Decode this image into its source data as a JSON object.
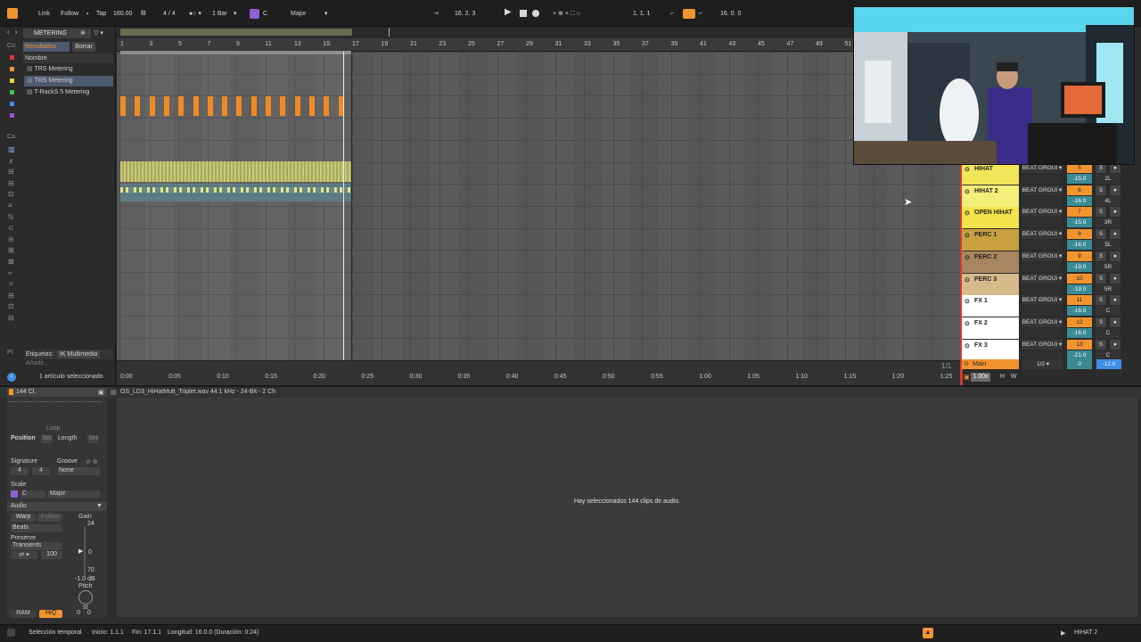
{
  "topbar": {
    "link": "Link",
    "follow": "Follow",
    "tap": "Tap",
    "tempo": "160.00",
    "signature": "4 / 4",
    "quantize": "1 Bar",
    "key": "C",
    "scale": "Major",
    "position": "16.  2.  3",
    "loop_start": "1.  1.  1",
    "loop_length": "16.  0.  0"
  },
  "browser": {
    "title": "METERING",
    "results_label": "Resultados",
    "clear_label": "Borrar",
    "column_name": "Nombre",
    "items": [
      "TRS Metering",
      "TRS Metering",
      "T-RackS 5 Metering"
    ],
    "tags_label": "Etiquetas:",
    "tags_value": "IK Multimedia",
    "add_label": "Añadir...",
    "selected_info": "1 artículo seleccionado",
    "sidebar_labels": [
      "Co.",
      "Ca.",
      "Pl."
    ]
  },
  "ruler": {
    "bars": [
      "1",
      "3",
      "5",
      "7",
      "9",
      "11",
      "13",
      "15",
      "17",
      "19",
      "21",
      "23",
      "25",
      "27",
      "29",
      "31",
      "33",
      "35",
      "37",
      "39",
      "41",
      "43",
      "45",
      "47",
      "49",
      "51"
    ],
    "times": [
      "0:00",
      "0:05",
      "0:10",
      "0:15",
      "0:20",
      "0:25",
      "0:30",
      "0:35",
      "0:40",
      "0:45",
      "0:50",
      "0:55",
      "1:00",
      "1:05",
      "1:10",
      "1:15",
      "1:20",
      "1:25"
    ],
    "page": "1/1"
  },
  "mixer": {
    "tracks": [
      {
        "name": "HIHAT",
        "color": "#f1e65a",
        "route": "BEAT GROUI",
        "num": "5",
        "vol": "-15.0",
        "pan": "2L"
      },
      {
        "name": "HIHAT 2",
        "color": "#f4ee7a",
        "route": "BEAT GROUI",
        "num": "6",
        "vol": "-16.0",
        "pan": "4L"
      },
      {
        "name": "OPEN HIHAT",
        "color": "#f2e34a",
        "route": "BEAT GROUI",
        "num": "7",
        "vol": "-15.0",
        "pan": "3R"
      },
      {
        "name": "PERC 1",
        "color": "#c9a040",
        "route": "BEAT GROUI",
        "num": "8",
        "vol": "-16.0",
        "pan": "5L"
      },
      {
        "name": "PERC 2",
        "color": "#a88760",
        "route": "BEAT GROUI",
        "num": "9",
        "vol": "-19.0",
        "pan": "5R"
      },
      {
        "name": "PERC 3",
        "color": "#d7b98a",
        "route": "BEAT GROUI",
        "num": "10",
        "vol": "-19.0",
        "pan": "5R"
      },
      {
        "name": "FX 1",
        "color": "#ffffff",
        "route": "BEAT GROUI",
        "num": "11",
        "vol": "-16.0",
        "pan": "C"
      },
      {
        "name": "FX 2",
        "color": "#ffffff",
        "route": "BEAT GROUI",
        "num": "12",
        "vol": "-16.0",
        "pan": "C"
      },
      {
        "name": "FX 3",
        "color": "#ffffff",
        "route": "BEAT GROUI",
        "num": "13",
        "vol": "-21.0",
        "pan": "C"
      }
    ],
    "main": {
      "name": "Main",
      "route": "1/2",
      "vol": "0",
      "pan": "-12.0"
    },
    "zoom": "1.00x",
    "h_label": "H",
    "w_label": "W",
    "solo_label": "S"
  },
  "clip": {
    "name": "144 Cl.",
    "loop_label": "Loop",
    "position_label": "Position",
    "set_label": "Set",
    "length_label": "Length",
    "signature_label": "Signature",
    "sig_num": "4",
    "sig_den": "4",
    "groove_label": "Groove",
    "groove_value": "None",
    "scale_label": "Scale",
    "scale_key": "C",
    "scale_mode": "Major",
    "audio_label": "Audio",
    "warp_label": "Warp",
    "follow_label": "Follow",
    "gain_label": "Gain",
    "gain_top": "24",
    "gain_mid": "0",
    "gain_bot": "70",
    "gain_db": "-1.0 dB",
    "warp_mode": "Beats",
    "preserve_label": "Preserve",
    "preserve_value": "Transients",
    "amount": "100",
    "pitch_label": "Pitch",
    "pitch_unit": "st",
    "ram_label": "RAM",
    "hiq_label": "HiQ",
    "transpose": "0",
    "detune": "0"
  },
  "sample": {
    "file": "OS_LD3_HiHatMult_Triplet.wav  44.1 kHz - 24-Bit - 2 Ch",
    "message": "Hay seleccionados 144 clips de audio."
  },
  "status": {
    "mode": "Selección temporal",
    "start": "Inicio: 1.1.1",
    "end": "Fin: 17.1.1",
    "length": "Longitud: 16.0.0 (Duración: 0:24)",
    "track": "HIHAT 2"
  },
  "colors": {
    "accent": "#f1942f",
    "clip_orange": "#f08a24",
    "clip_yellow": "#d6d77a",
    "selected": "#4c5a6e"
  }
}
